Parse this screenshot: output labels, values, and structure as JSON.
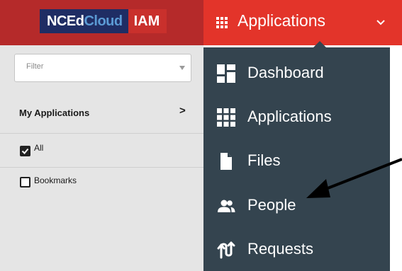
{
  "header": {
    "brand_part_a_1": "NCEd",
    "brand_part_a_2": "Cloud",
    "brand_part_b": "IAM",
    "menu_title": "Applications",
    "brand_color": "#b52a2a",
    "accent_color": "#e3342a"
  },
  "sidebar": {
    "filter_placeholder": "Filter",
    "section_label": "My Applications",
    "section_chevron": ">",
    "items": [
      {
        "label": "All",
        "checked": true
      },
      {
        "label": "Bookmarks",
        "checked": false
      }
    ]
  },
  "menu": {
    "background": "#34444f",
    "items": [
      {
        "label": "Dashboard",
        "icon": "dashboard-icon"
      },
      {
        "label": "Applications",
        "icon": "grid-icon"
      },
      {
        "label": "Files",
        "icon": "file-icon"
      },
      {
        "label": "People",
        "icon": "people-icon"
      },
      {
        "label": "Requests",
        "icon": "requests-icon"
      }
    ]
  }
}
